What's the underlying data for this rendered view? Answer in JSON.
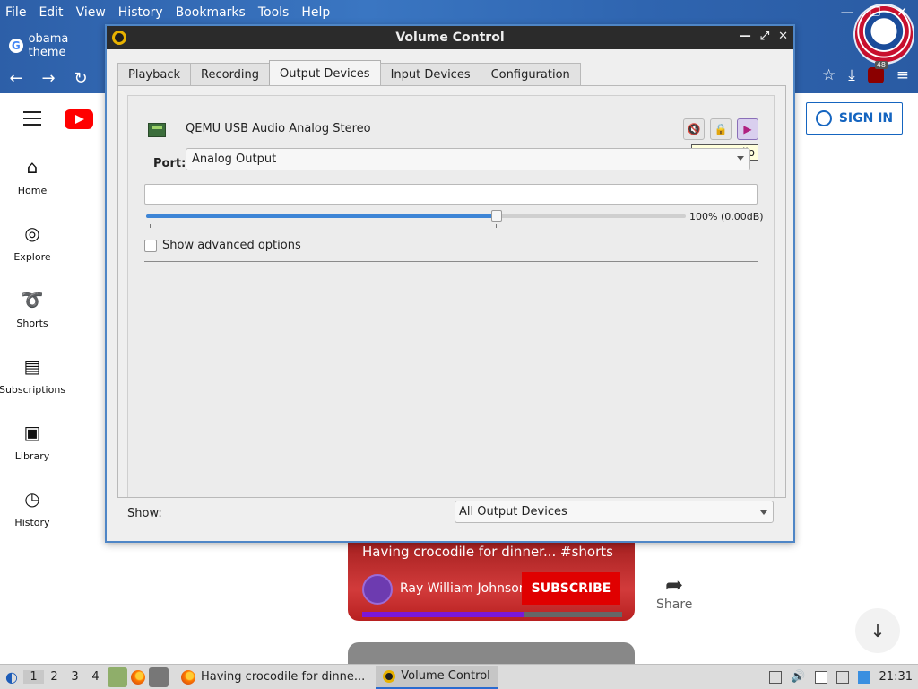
{
  "firefox": {
    "menu": [
      "File",
      "Edit",
      "View",
      "History",
      "Bookmarks",
      "Tools",
      "Help"
    ],
    "tab_title": "obama theme",
    "wm_controls": [
      "—",
      "❐",
      "✕"
    ],
    "ublock_count": "48"
  },
  "youtube": {
    "sidebar": [
      {
        "label": "Home",
        "icon": "home-icon"
      },
      {
        "label": "Explore",
        "icon": "compass-icon"
      },
      {
        "label": "Shorts",
        "icon": "shorts-icon"
      },
      {
        "label": "Subscriptions",
        "icon": "subscriptions-icon"
      },
      {
        "label": "Library",
        "icon": "library-icon"
      },
      {
        "label": "History",
        "icon": "history-icon"
      }
    ],
    "sign_in": "SIGN IN",
    "short_title": "Having crocodile for dinner... #shorts",
    "channel_name": "Ray William Johnson",
    "subscribe": "SUBSCRIBE",
    "share": "Share",
    "progress_fraction": 0.62
  },
  "volume_control": {
    "title": "Volume Control",
    "tabs": [
      {
        "label": "Playback",
        "active": false
      },
      {
        "label": "Recording",
        "active": false
      },
      {
        "label": "Output Devices",
        "active": true
      },
      {
        "label": "Input Devices",
        "active": false
      },
      {
        "label": "Configuration",
        "active": false
      }
    ],
    "device_name": "QEMU USB Audio Analog Stereo",
    "tooltip": "Mute audio",
    "port_label": "Port:",
    "port_value": "Analog Output",
    "volume_fraction": 0.65,
    "volume_text": "100% (0.00dB)",
    "advanced_label": "Show advanced options",
    "show_label": "Show:",
    "show_value": "All Output Devices"
  },
  "taskbar": {
    "workspaces": [
      "1",
      "2",
      "3",
      "4"
    ],
    "active_workspace": "1",
    "tasks": [
      {
        "label": "Having crocodile for dinne...",
        "active": false
      },
      {
        "label": "Volume Control",
        "active": true
      }
    ],
    "clock": "21:31"
  }
}
